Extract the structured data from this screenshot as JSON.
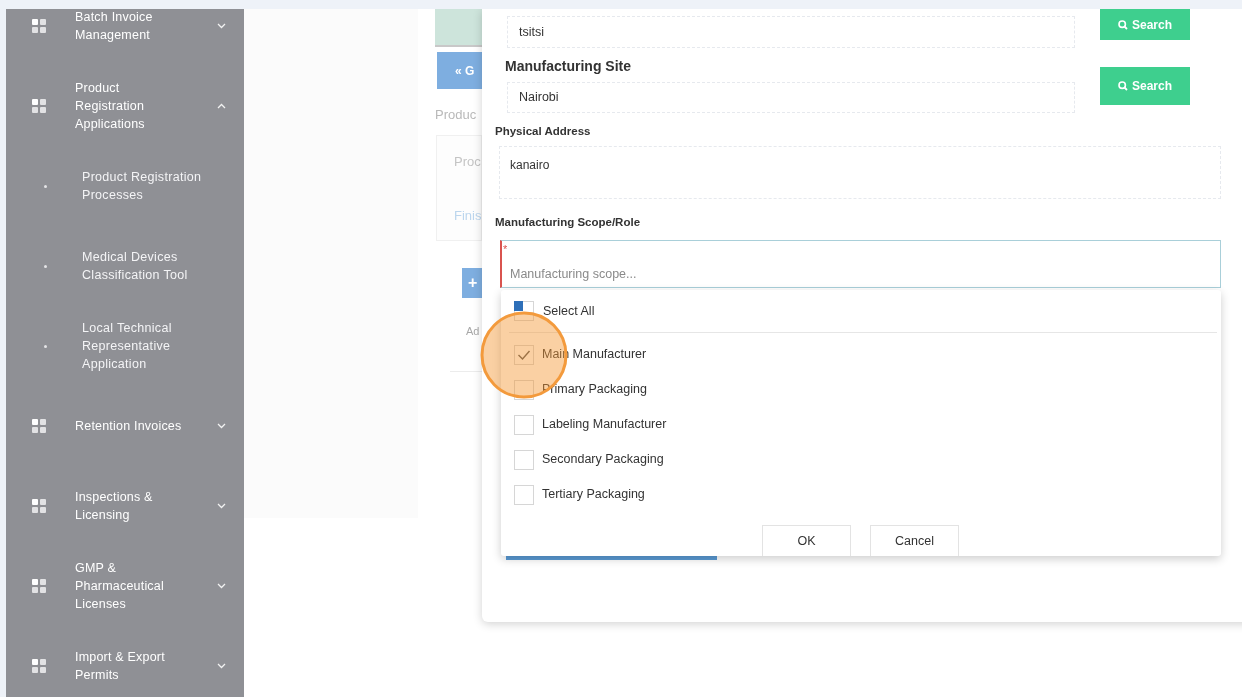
{
  "sidebar": {
    "items": [
      {
        "kind": "group",
        "label": "Batch Invoice Management",
        "expanded": false
      },
      {
        "kind": "group",
        "label": "Product Registration Applications",
        "expanded": true
      },
      {
        "kind": "sub",
        "label": "Product Registration Processes"
      },
      {
        "kind": "sub",
        "label": "Medical Devices Classification Tool"
      },
      {
        "kind": "sub",
        "label": "Local Technical Representative Application"
      },
      {
        "kind": "group",
        "label": "Retention Invoices",
        "expanded": false
      },
      {
        "kind": "group",
        "label": "Inspections & Licensing",
        "expanded": false
      },
      {
        "kind": "group",
        "label": "GMP & Pharmaceutical Licenses",
        "expanded": false
      },
      {
        "kind": "group",
        "label": "Import & Export Permits",
        "expanded": false
      }
    ]
  },
  "background_page": {
    "back_button": "« G",
    "heading": "Produc",
    "list_items": [
      "Proc",
      "Finis"
    ],
    "add_button": "+",
    "link": "Ad"
  },
  "modal": {
    "manufacturer": {
      "value": "tsitsi",
      "button": "Search"
    },
    "site": {
      "label": "Manufacturing Site",
      "value": "Nairobi",
      "button": "Search"
    },
    "physical_address": {
      "label": "Physical Address",
      "value": "kanairo"
    },
    "scope": {
      "label": "Manufacturing Scope/Role",
      "required_mark": "*",
      "placeholder": "Manufacturing scope..."
    },
    "dropdown": {
      "select_all": {
        "label": "Select All",
        "indeterminate": true
      },
      "options": [
        {
          "label": "Main Manufacturer",
          "checked": true
        },
        {
          "label": "Primary Packaging",
          "checked": false
        },
        {
          "label": "Labeling Manufacturer",
          "checked": false
        },
        {
          "label": "Secondary Packaging",
          "checked": false
        },
        {
          "label": "Tertiary Packaging",
          "checked": false
        }
      ],
      "buttons": [
        "OK",
        "Cancel"
      ]
    }
  }
}
